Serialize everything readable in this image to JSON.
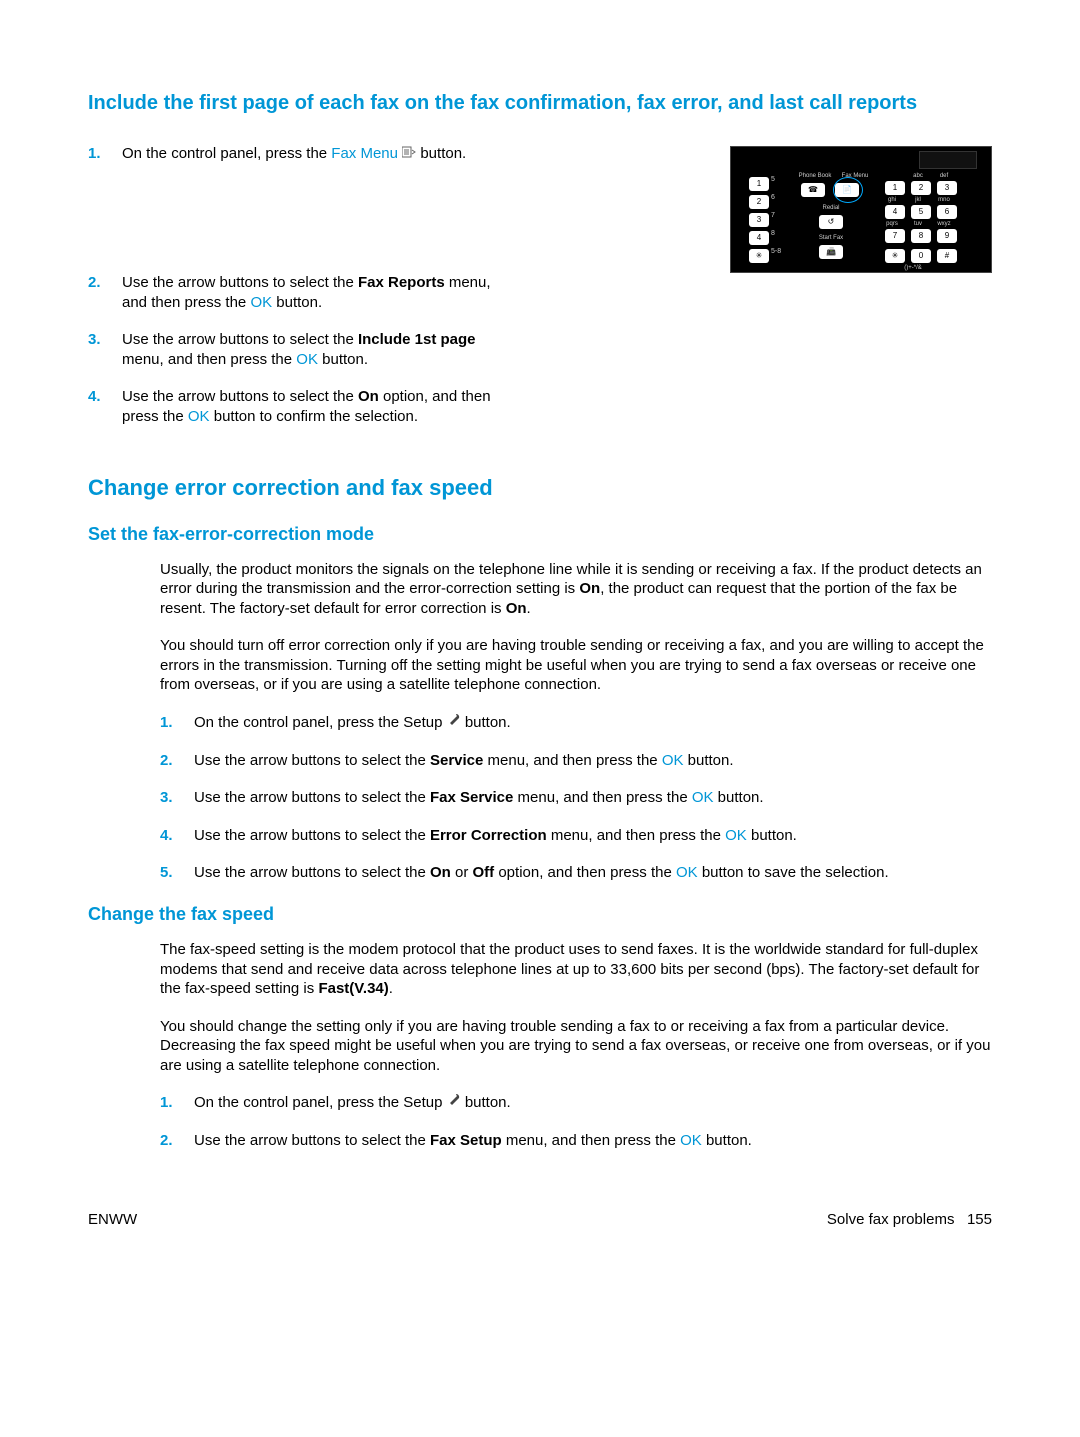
{
  "section1": {
    "title": "Include the first page of each fax on the fax confirmation, fax error, and last call reports",
    "steps": [
      {
        "pre": "On the control panel, press the ",
        "link": "Fax Menu",
        "post": " button.",
        "icon": "fax-menu"
      },
      {
        "text_parts": [
          "Use the arrow buttons to select the ",
          "Fax Reports",
          " menu, and then press the ",
          "OK",
          " button."
        ],
        "bold_idx": [
          1
        ],
        "link_idx": [
          3
        ]
      },
      {
        "text_parts": [
          "Use the arrow buttons to select the ",
          "Include 1st page",
          " menu, and then press the ",
          "OK",
          " button."
        ],
        "bold_idx": [
          1
        ],
        "link_idx": [
          3
        ]
      },
      {
        "text_parts": [
          "Use the arrow buttons to select the ",
          "On",
          " option, and then press the ",
          "OK",
          " button to confirm the selection."
        ],
        "bold_idx": [
          1
        ],
        "link_idx": [
          3
        ]
      }
    ],
    "panel": {
      "labels": {
        "phone_book": "Phone Book",
        "fax_menu": "Fax Menu",
        "redial": "Redial",
        "start_fax": "Start Fax",
        "abc": "abc",
        "def": "def",
        "ghi": "ghi",
        "jkl": "jkl",
        "mno": "mno",
        "pqrs": "pqrs",
        "tuv": "tuv",
        "wxyz": "wxyz",
        "sym": "()+-*/&"
      },
      "left_keys": [
        "1",
        "2",
        "3",
        "4",
        "✳"
      ],
      "left_sup": [
        "5",
        "6",
        "7",
        "8",
        "5-8"
      ],
      "keypad": [
        [
          "1",
          "2",
          "3"
        ],
        [
          "4",
          "5",
          "6"
        ],
        [
          "7",
          "8",
          "9"
        ],
        [
          "✳",
          "0",
          "#"
        ]
      ]
    }
  },
  "section2": {
    "title": "Change error correction and fax speed",
    "sub1": {
      "title": "Set the fax-error-correction mode",
      "p1_parts": [
        "Usually, the product monitors the signals on the telephone line while it is sending or receiving a fax. If the product detects an error during the transmission and the error-correction setting is ",
        "On",
        ", the product can request that the portion of the fax be resent. The factory-set default for error correction is ",
        "On",
        "."
      ],
      "p2": "You should turn off error correction only if you are having trouble sending or receiving a fax, and you are willing to accept the errors in the transmission. Turning off the setting might be useful when you are trying to send a fax overseas or receive one from overseas, or if you are using a satellite telephone connection.",
      "steps": [
        {
          "pre": "On the control panel, press the Setup ",
          "icon": "wrench",
          "post": " button."
        },
        {
          "text_parts": [
            "Use the arrow buttons to select the ",
            "Service",
            " menu, and then press the ",
            "OK",
            " button."
          ],
          "bold_idx": [
            1
          ],
          "link_idx": [
            3
          ]
        },
        {
          "text_parts": [
            "Use the arrow buttons to select the ",
            "Fax Service",
            " menu, and then press the ",
            "OK",
            " button."
          ],
          "bold_idx": [
            1
          ],
          "link_idx": [
            3
          ]
        },
        {
          "text_parts": [
            "Use the arrow buttons to select the ",
            "Error Correction",
            " menu, and then press the ",
            "OK",
            " button."
          ],
          "bold_idx": [
            1
          ],
          "link_idx": [
            3
          ]
        },
        {
          "text_parts": [
            "Use the arrow buttons to select the ",
            "On",
            " or ",
            "Off",
            " option, and then press the ",
            "OK",
            " button to save the selection."
          ],
          "bold_idx": [
            1,
            3
          ],
          "link_idx": [
            5
          ]
        }
      ]
    },
    "sub2": {
      "title": "Change the fax speed",
      "p1_parts": [
        "The fax-speed setting is the modem protocol that the product uses to send faxes. It is the worldwide standard for full-duplex modems that send and receive data across telephone lines at up to 33,600 bits per second (bps). The factory-set default for the fax-speed setting is ",
        "Fast(V.34)",
        "."
      ],
      "p2": "You should change the setting only if you are having trouble sending a fax to or receiving a fax from a particular device. Decreasing the fax speed might be useful when you are trying to send a fax overseas, or receive one from overseas, or if you are using a satellite telephone connection.",
      "steps": [
        {
          "pre": "On the control panel, press the Setup ",
          "icon": "wrench",
          "post": " button."
        },
        {
          "text_parts": [
            "Use the arrow buttons to select the ",
            "Fax Setup",
            " menu, and then press the ",
            "OK",
            " button."
          ],
          "bold_idx": [
            1
          ],
          "link_idx": [
            3
          ]
        }
      ]
    }
  },
  "footer": {
    "left": "ENWW",
    "right_label": "Solve fax problems",
    "page": "155"
  }
}
